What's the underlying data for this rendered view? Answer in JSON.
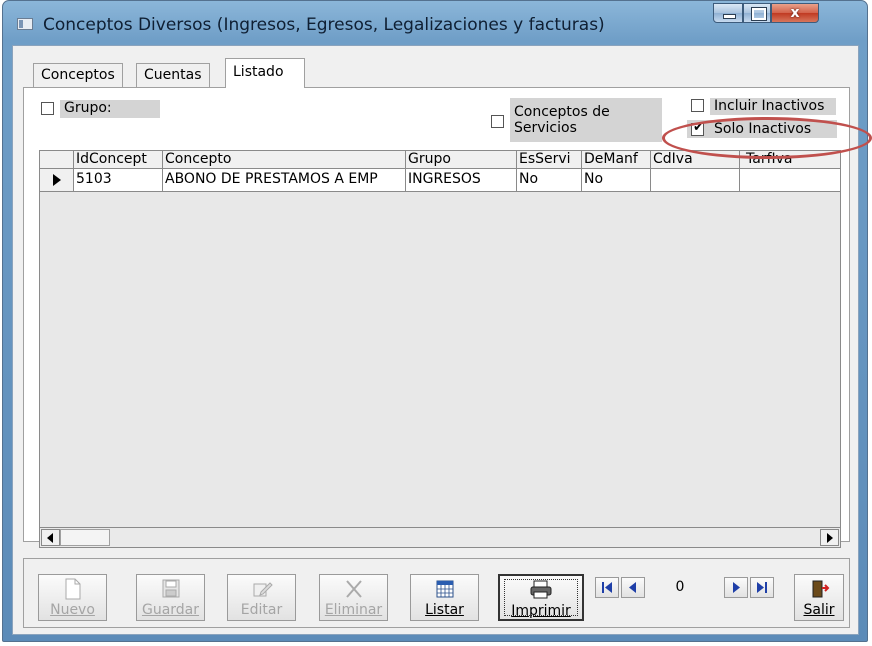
{
  "window": {
    "title": "Conceptos Diversos (Ingresos, Egresos, Legalizaciones y facturas)",
    "close_glyph": "x"
  },
  "tabs": [
    {
      "label": "Conceptos"
    },
    {
      "label": "Cuentas"
    },
    {
      "label": "Listado"
    }
  ],
  "filters": {
    "grupo_label": "Grupo:",
    "grupo_checked": false,
    "servicios_label_1": "Conceptos de",
    "servicios_label_2": "Servicios",
    "servicios_checked": false,
    "incluir_inactivos_label": "Incluir Inactivos",
    "incluir_inactivos_checked": false,
    "solo_inactivos_label": "Solo Inactivos",
    "solo_inactivos_checked": true
  },
  "grid": {
    "columns": [
      "IdConcept",
      "Concepto",
      "Grupo",
      "EsServi",
      "DeManf",
      "CdIva",
      "TarfIva"
    ],
    "rows": [
      [
        "5103",
        "ABONO DE PRESTAMOS A EMP",
        "INGRESOS",
        "No",
        "No",
        "",
        ""
      ]
    ]
  },
  "toolbar": {
    "nuevo": "Nuevo",
    "guardar": "Guardar",
    "editar": "Editar",
    "eliminar": "Eliminar",
    "listar": "Listar",
    "imprimir": "Imprimir",
    "record_position": "0",
    "salir": "Salir"
  },
  "colors": {
    "annotation": "#c0504d",
    "title_gradient_top": "#8bb6d9"
  }
}
